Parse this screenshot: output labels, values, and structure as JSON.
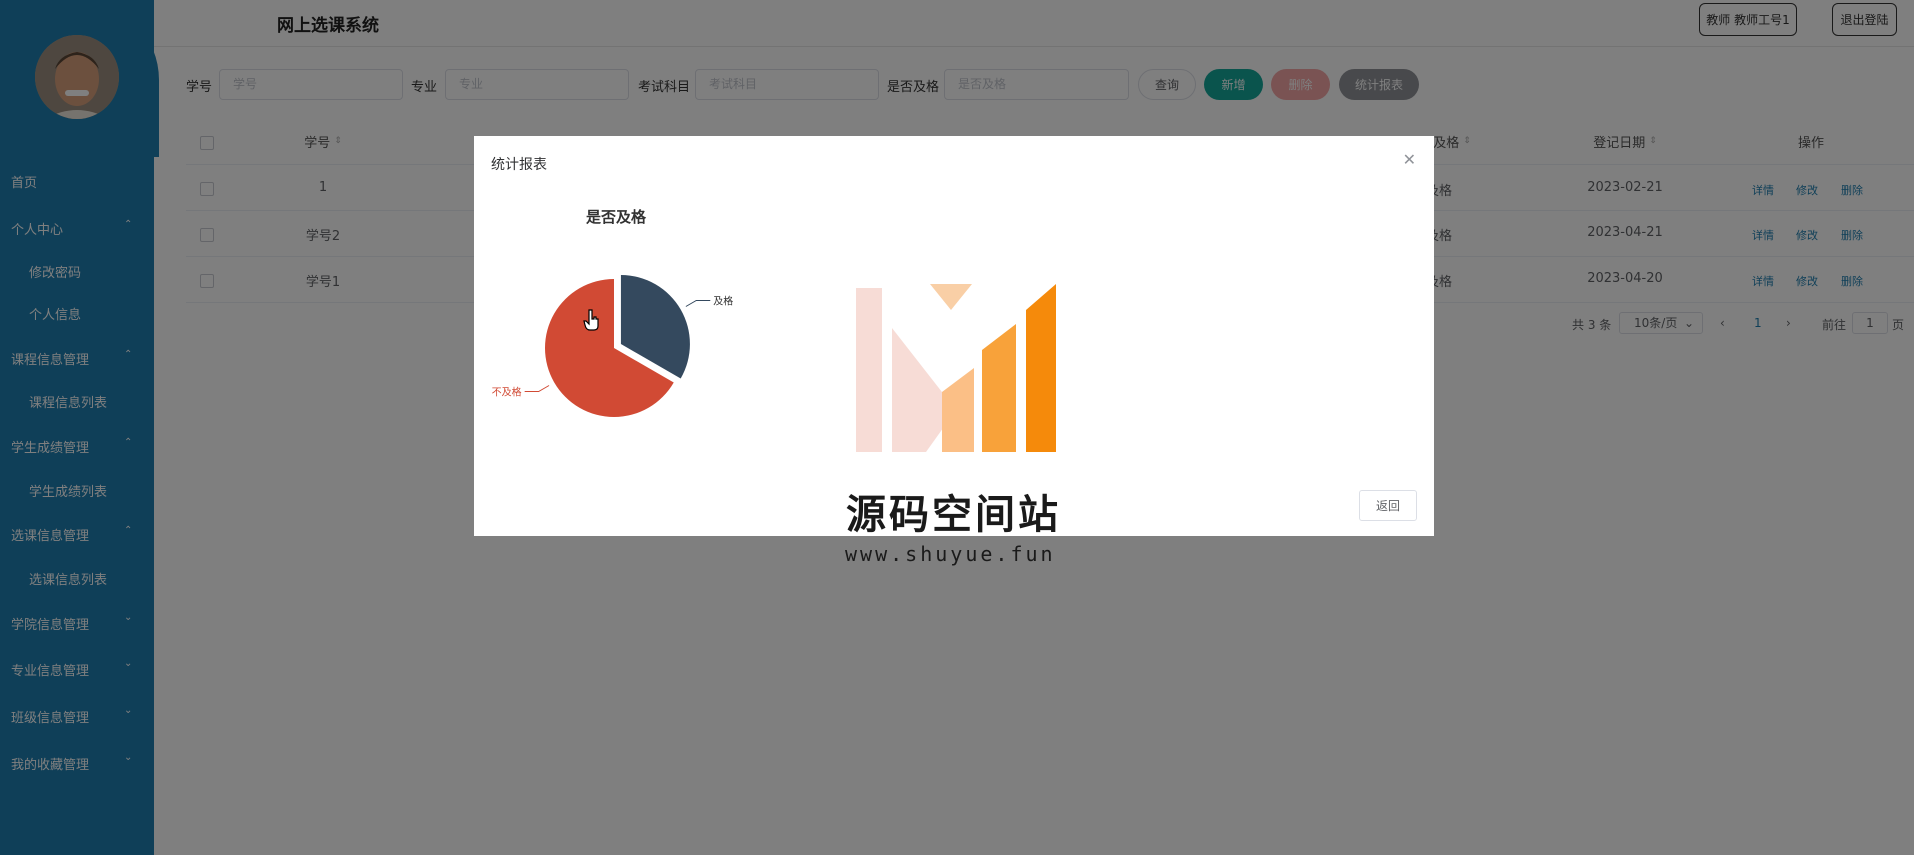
{
  "app": {
    "title": "网上选课系统"
  },
  "topbar": {
    "user_label": "教师 教师工号1",
    "logout_label": "退出登陆"
  },
  "sidebar": {
    "items": [
      {
        "label": "首页"
      },
      {
        "label": "个人中心"
      },
      {
        "label": "修改密码"
      },
      {
        "label": "个人信息"
      },
      {
        "label": "课程信息管理"
      },
      {
        "label": "课程信息列表"
      },
      {
        "label": "学生成绩管理"
      },
      {
        "label": "学生成绩列表"
      },
      {
        "label": "选课信息管理"
      },
      {
        "label": "选课信息列表"
      },
      {
        "label": "学院信息管理"
      },
      {
        "label": "专业信息管理"
      },
      {
        "label": "班级信息管理"
      },
      {
        "label": "我的收藏管理"
      }
    ]
  },
  "search": {
    "fields": [
      {
        "label": "学号",
        "placeholder": "学号"
      },
      {
        "label": "专业",
        "placeholder": "专业"
      },
      {
        "label": "考试科目",
        "placeholder": "考试科目"
      },
      {
        "label": "是否及格",
        "placeholder": "是否及格"
      }
    ],
    "query_label": "查询",
    "add_label": "新增",
    "delete_label": "删除",
    "report_label": "统计报表"
  },
  "table": {
    "headers": {
      "student_id": "学号",
      "passed": "是否及格",
      "date": "登记日期",
      "actions": "操作"
    },
    "rows": [
      {
        "student_id": "1",
        "passed": "及格",
        "date": "2023-02-21"
      },
      {
        "student_id": "学号2",
        "passed": "及格",
        "date": "2023-04-21"
      },
      {
        "student_id": "学号1",
        "passed": "及格",
        "date": "2023-04-20"
      }
    ],
    "actions": {
      "detail": "详情",
      "edit": "修改",
      "delete": "删除"
    }
  },
  "pagination": {
    "total_label": "共 3 条",
    "page_size": "10条/页",
    "current_page": "1",
    "goto_label": "前往",
    "goto_value": "1",
    "page_suffix": "页"
  },
  "dialog": {
    "title": "统计报表",
    "return_label": "返回"
  },
  "chart_data": {
    "type": "pie",
    "title": "是否及格",
    "categories": [
      "及格",
      "不及格"
    ],
    "values": [
      1,
      2
    ],
    "colors": [
      "#34495e",
      "#d14a34"
    ]
  },
  "watermark": {
    "text": "源码空间站",
    "url": "www.shuyue.fun"
  }
}
